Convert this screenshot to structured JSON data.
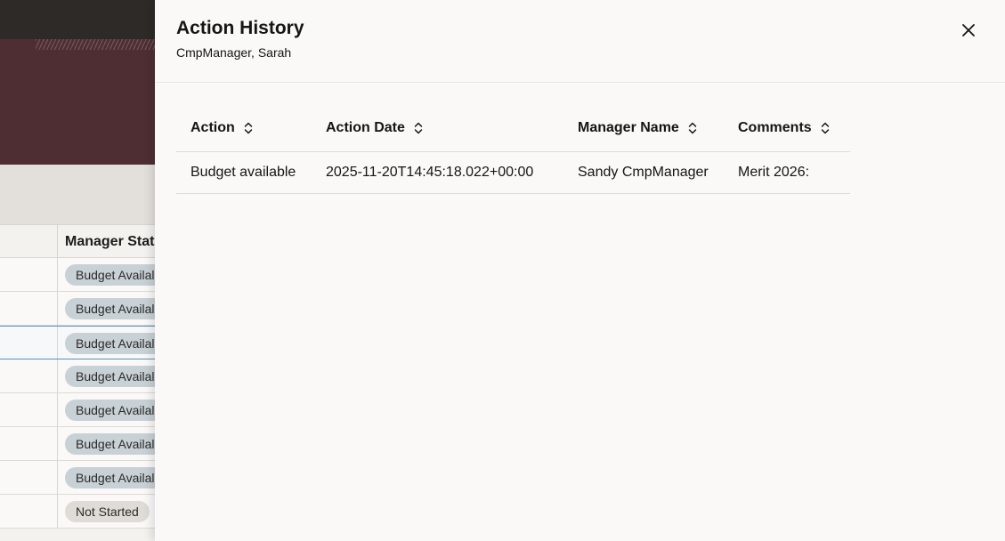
{
  "background": {
    "table_header": "Manager Stat",
    "rows": [
      {
        "status": "Budget Availal"
      },
      {
        "status": "Budget Availal"
      },
      {
        "status": "Budget Availal"
      },
      {
        "status": "Budget Availal"
      },
      {
        "status": "Budget Availal"
      },
      {
        "status": "Budget Availal"
      },
      {
        "status": "Budget Availal"
      },
      {
        "status": "Not Started"
      }
    ]
  },
  "drawer": {
    "title": "Action History",
    "subtitle": "CmpManager, Sarah",
    "close_icon": "close-icon",
    "table": {
      "columns": [
        {
          "label": "Action",
          "sort_icon": "sort-icon"
        },
        {
          "label": "Action Date",
          "sort_icon": "sort-icon"
        },
        {
          "label": "Manager Name",
          "sort_icon": "sort-icon"
        },
        {
          "label": "Comments",
          "sort_icon": "sort-icon"
        }
      ],
      "rows": [
        {
          "action": "Budget available",
          "action_date": "2025-11-20T14:45:18.022+00:00",
          "manager_name": "Sandy CmpManager",
          "comments": "Merit 2026:"
        }
      ]
    }
  },
  "colors": {
    "topbar": "#2e2a28",
    "banner": "#4e2e33",
    "drawer_bg": "#faf9f7",
    "chip_budget": "#c8d1d6",
    "chip_not_started": "#dfdcd7",
    "selected_row_border": "#5f8fb3"
  }
}
